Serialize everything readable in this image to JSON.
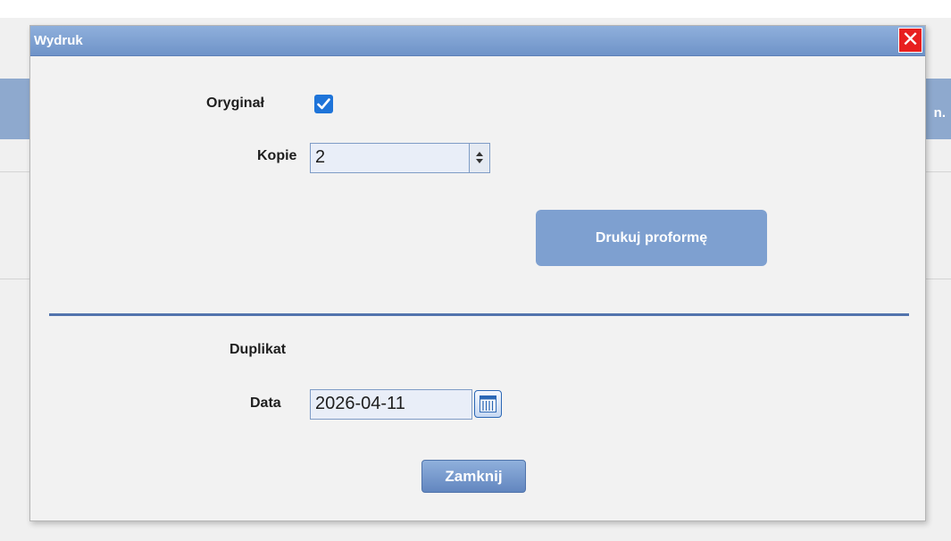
{
  "background": {
    "header_fragment": "n."
  },
  "dialog": {
    "title": "Wydruk",
    "close_glyph": "✕",
    "original": {
      "label": "Oryginał",
      "checked": true
    },
    "copies": {
      "label": "Kopie",
      "value": "2"
    },
    "print_proforma_label": "Drukuj proformę",
    "duplicate": {
      "heading": "Duplikat",
      "date_label": "Data",
      "date_value": "2026-04-11"
    },
    "close_label": "Zamknij"
  },
  "colors": {
    "titlebar": "#7a9ccf",
    "accent": "#5274ad",
    "checkbox": "#1e74d9",
    "close_red": "#e81f1f"
  },
  "icons": {
    "checkbox": "checkmark-icon",
    "spinner": "spinner-arrows-icon",
    "calendar": "calendar-icon",
    "close": "close-icon"
  }
}
